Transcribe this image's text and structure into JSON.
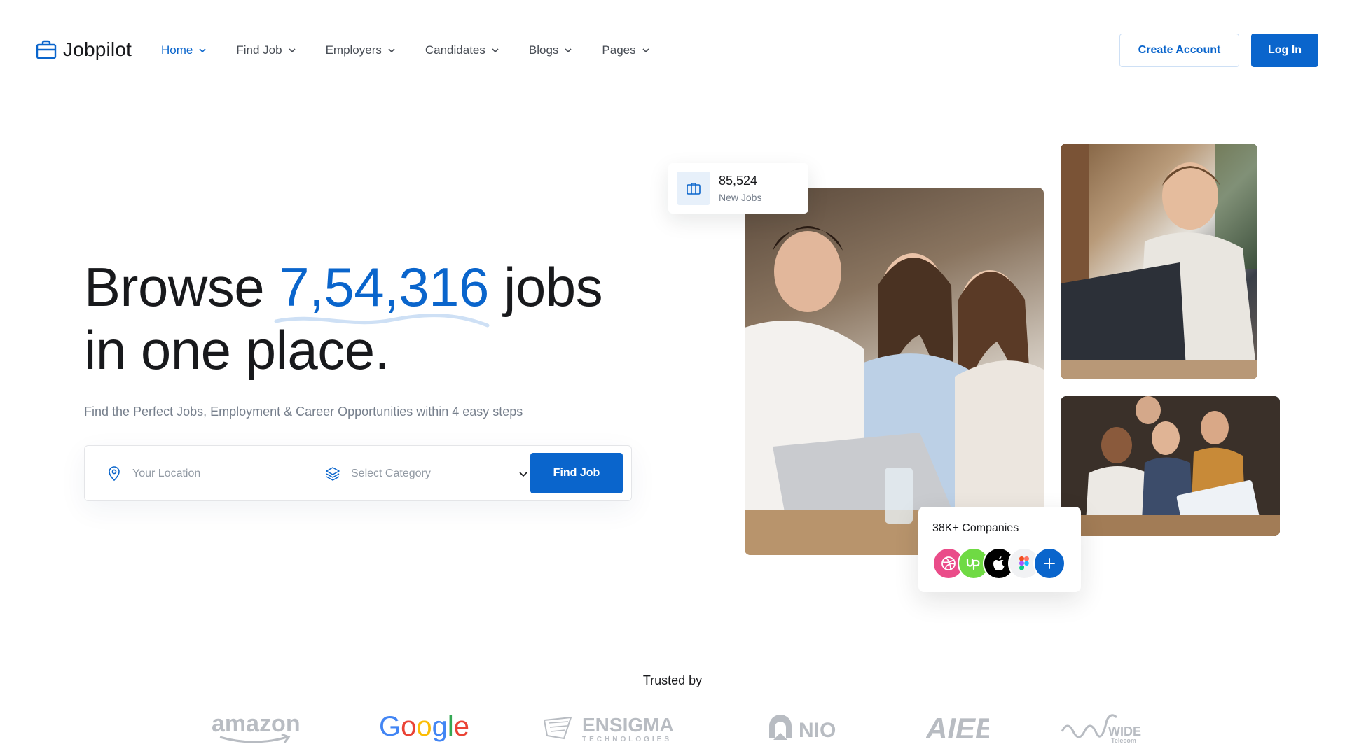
{
  "brand": {
    "name": "Jobpilot"
  },
  "nav": {
    "items": [
      {
        "label": "Home",
        "active": true
      },
      {
        "label": "Find Job",
        "active": false
      },
      {
        "label": "Employers",
        "active": false
      },
      {
        "label": "Candidates",
        "active": false
      },
      {
        "label": "Blogs",
        "active": false
      },
      {
        "label": "Pages",
        "active": false
      }
    ]
  },
  "header": {
    "create_account": "Create Account",
    "login": "Log In"
  },
  "hero": {
    "title_pre": "Browse ",
    "title_count": "7,54,316",
    "title_post": " jobs",
    "title_line2": "in one place.",
    "subtitle": "Find the Perfect Jobs, Employment & Career Opportunities within 4 easy steps"
  },
  "search": {
    "location_placeholder": "Your Location",
    "category_placeholder": "Select Category",
    "button": "Find Job"
  },
  "stats": {
    "jobs_count": "85,524",
    "jobs_label": "New Jobs",
    "companies_label": "38K+ Companies"
  },
  "trusted": {
    "label": "Trusted by",
    "brands": [
      "amazon",
      "Google",
      "ENSIGMA",
      "NIO",
      "AIEE",
      "WIDE"
    ]
  },
  "colors": {
    "primary": "#0a65cc",
    "text": "#18191c",
    "muted": "#767f8c"
  }
}
